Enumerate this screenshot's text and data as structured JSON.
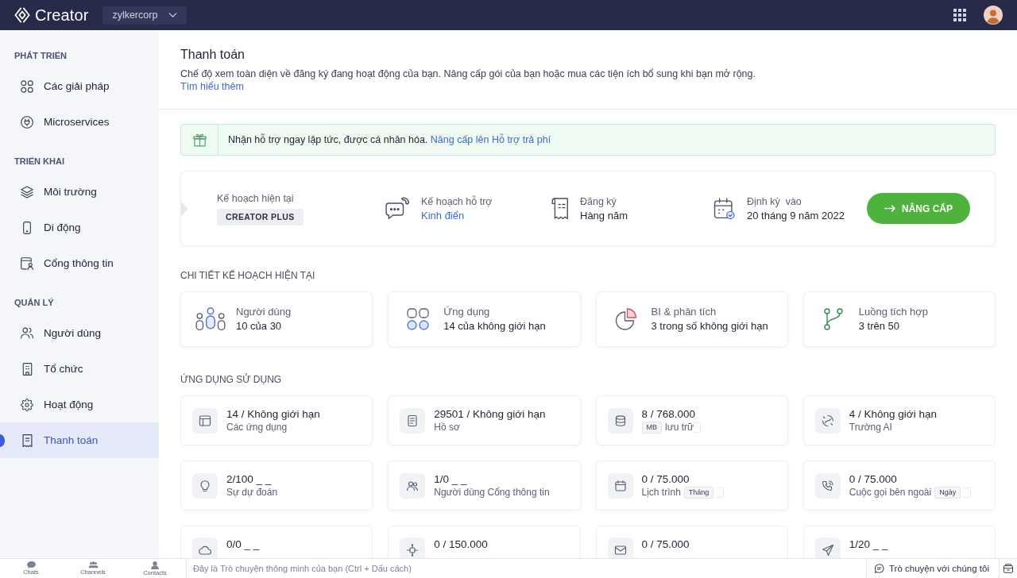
{
  "topbar": {
    "app_name": "Creator",
    "org": "zylkercorp"
  },
  "sidebar": {
    "sections": [
      {
        "title": "PHÁT TRIỂN",
        "items": [
          {
            "label": "Các giải pháp",
            "selected": false
          },
          {
            "label": "Microservices",
            "selected": false
          }
        ]
      },
      {
        "title": "TRIỂN KHAI",
        "items": [
          {
            "label": "Môi trường",
            "selected": false
          },
          {
            "label": "Di động",
            "selected": false
          },
          {
            "label": "Cổng thông tin",
            "selected": false
          }
        ]
      },
      {
        "title": "QUẢN LÝ",
        "items": [
          {
            "label": "Người dùng",
            "selected": false
          },
          {
            "label": "Tổ chức",
            "selected": false
          },
          {
            "label": "Hoạt động",
            "selected": false
          },
          {
            "label": "Thanh toán",
            "selected": true
          }
        ]
      }
    ]
  },
  "header": {
    "title": "Thanh toán",
    "description": "Chế độ xem toàn diện về đăng ký đang hoạt động của bạn. Nâng cấp gói của bạn hoặc mua các tiện ích bổ sung khi bạn mở rộng.",
    "link": "Tìm hiểu thêm"
  },
  "banner": {
    "text": "Nhận hỗ trợ ngay lập tức, được cá nhân hóa.",
    "link": "Nâng cấp lên Hỗ trợ trả phí"
  },
  "plan": {
    "items": [
      {
        "label": "Kế hoạch hiện tại",
        "value": "CREATOR PLUS",
        "kind": "badge"
      },
      {
        "label": "Kế hoạch hỗ trợ",
        "value": "Kinh điển",
        "kind": "link"
      },
      {
        "label": "Đăng ký",
        "value": "Hàng năm",
        "kind": "text"
      },
      {
        "label": "Định kỳ  vào",
        "value": "20 tháng 9 năm 2022",
        "kind": "text"
      }
    ],
    "button": "NÂNG CẤP"
  },
  "plan_details": {
    "title": "CHI TIẾT KẾ HOẠCH HIỆN TẠI",
    "cards": [
      {
        "label": "Người dùng",
        "value": "10 của 30"
      },
      {
        "label": "Ứng dụng",
        "value": "14 của không giới hạn"
      },
      {
        "label": "BI & phân tích",
        "value": "3 trong số không giới hạn"
      },
      {
        "label": "Luồng tích hợp",
        "value": "3 trên 50"
      }
    ]
  },
  "usage": {
    "title": "ỨNG DỤNG SỬ DỤNG",
    "cards": [
      {
        "value": "14 / Không giới hạn",
        "subtitle": [
          {
            "kind": "label",
            "text": "Các ứng dụng"
          }
        ]
      },
      {
        "value": "29501 / Không giới hạn",
        "subtitle": [
          {
            "kind": "label",
            "text": "Hồ sơ"
          }
        ]
      },
      {
        "value": "8 / 768.000",
        "subtitle": [
          {
            "kind": "tag",
            "text": "MB"
          },
          {
            "kind": "label",
            "text": "lưu trữ"
          }
        ]
      },
      {
        "value": "4 / Không giới hạn",
        "subtitle": [
          {
            "kind": "label",
            "text": "Trường AI"
          }
        ]
      },
      {
        "value": "2/100 _ _",
        "subtitle": [
          {
            "kind": "label",
            "text": "Sự dự đoán"
          }
        ]
      },
      {
        "value": "1/0 _ _",
        "subtitle": [
          {
            "kind": "label",
            "text": "Người dùng Cổng thông tin"
          }
        ]
      },
      {
        "value": "0 / 75.000",
        "subtitle": [
          {
            "kind": "label",
            "text": "Lịch trình"
          },
          {
            "kind": "tag",
            "text": "Tháng"
          }
        ]
      },
      {
        "value": "0 / 75.000",
        "subtitle": [
          {
            "kind": "label",
            "text": "Cuộc gọi bên ngoài"
          },
          {
            "kind": "tag",
            "text": "Ngày"
          }
        ]
      },
      {
        "value": "0/0 _ _"
      },
      {
        "value": "0 / 150.000"
      },
      {
        "value": "0 / 75.000"
      },
      {
        "value": "1/20 _ _"
      }
    ]
  },
  "bottom_bar": {
    "tabs": [
      {
        "label": "Chats"
      },
      {
        "label": "Channels"
      },
      {
        "label": "Contacts"
      }
    ],
    "placeholder": "Đây là Trò chuyện thông minh của bạn (Ctrl + Dấu cách)",
    "chat_button": "Trò chuyện với chúng tôi"
  }
}
